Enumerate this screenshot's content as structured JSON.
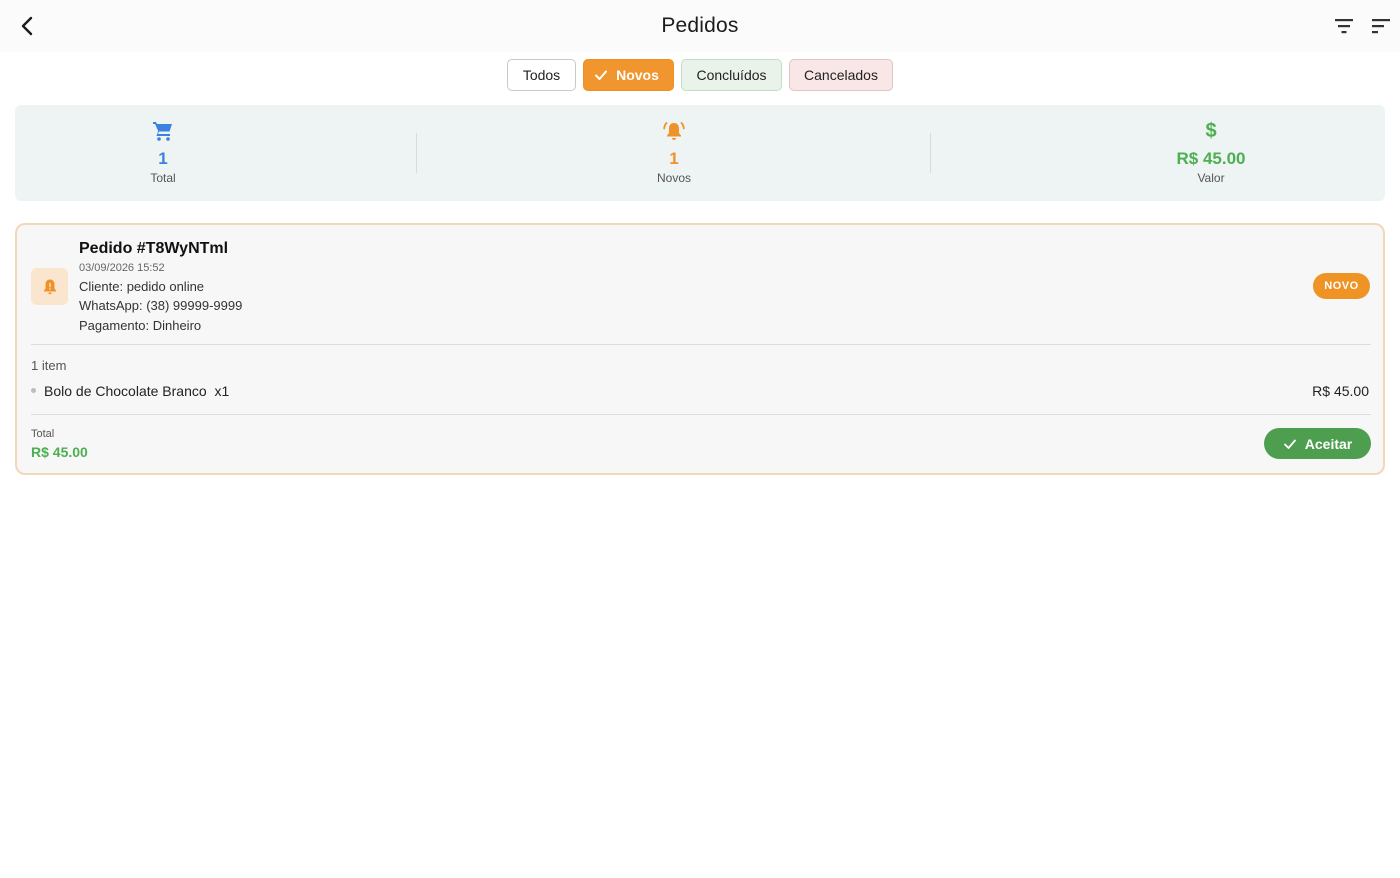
{
  "appbar": {
    "title": "Pedidos",
    "back_icon": "back-chevron-icon",
    "filter_icon": "filter-icon",
    "sort_icon": "sort-icon"
  },
  "filters": {
    "todos": "Todos",
    "novos": "Novos",
    "concluidos": "Concluídos",
    "cancelados": "Cancelados",
    "selected": "Novos"
  },
  "stats": {
    "total": {
      "value": "1",
      "label": "Total",
      "icon": "cart-icon",
      "color": "#3b82e0"
    },
    "novos": {
      "value": "1",
      "label": "Novos",
      "icon": "bell-ring-icon",
      "color": "#f0922a"
    },
    "valor": {
      "value": "R$ 45.00",
      "label": "Valor",
      "icon": "dollar-icon",
      "color": "#4caf50"
    }
  },
  "order": {
    "title": "Pedido #T8WyNTml",
    "date": "03/09/2026 15:52",
    "client": "Cliente: pedido online",
    "whatsapp": "WhatsApp: (38) 99999-9999",
    "payment": "Pagamento: Dinheiro",
    "status": "NOVO",
    "item_count": "1 item",
    "items": [
      {
        "name": "Bolo de Chocolate Branco  x1",
        "price": "R$ 45.00"
      }
    ],
    "total_label": "Total",
    "total_value": "R$ 45.00",
    "accept_label": "Aceitar"
  }
}
